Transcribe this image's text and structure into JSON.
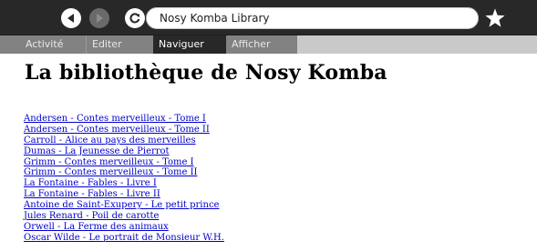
{
  "toolbar": {
    "url": "Nosy Komba Library",
    "icons": [
      "back-icon",
      "forward-icon",
      "reload-icon",
      "star-icon"
    ]
  },
  "tabs": [
    "Activité",
    "Editer",
    "Naviguer",
    "Afficher"
  ],
  "active_tab": "Naviguer",
  "page": {
    "title": "La bibliothèque de Nosy Komba",
    "books": [
      "Andersen - Contes merveilleux - Tome I",
      "Andersen - Contes merveilleux - Tome II",
      "Carroll - Alice au pays des merveilles",
      "Dumas - La Jeunesse de Pierrot",
      "Grimm - Contes merveilleux - Tome I",
      "Grimm - Contes merveilleux - Tome II",
      "La Fontaine - Fables - Livre I",
      "La Fontaine - Fables - Livre II",
      "Antoine de Saint-Exupery - Le petit prince",
      "Jules Renard - Poil de carotte",
      "Orwell - La Ferme des animaux",
      "Oscar Wilde - Le portrait de Monsieur W.H."
    ]
  },
  "colors": {
    "toolbar_bg": "#282828",
    "tab_bg": "#828282",
    "active_tab_bg": "#282828",
    "link": "#0000cc"
  }
}
